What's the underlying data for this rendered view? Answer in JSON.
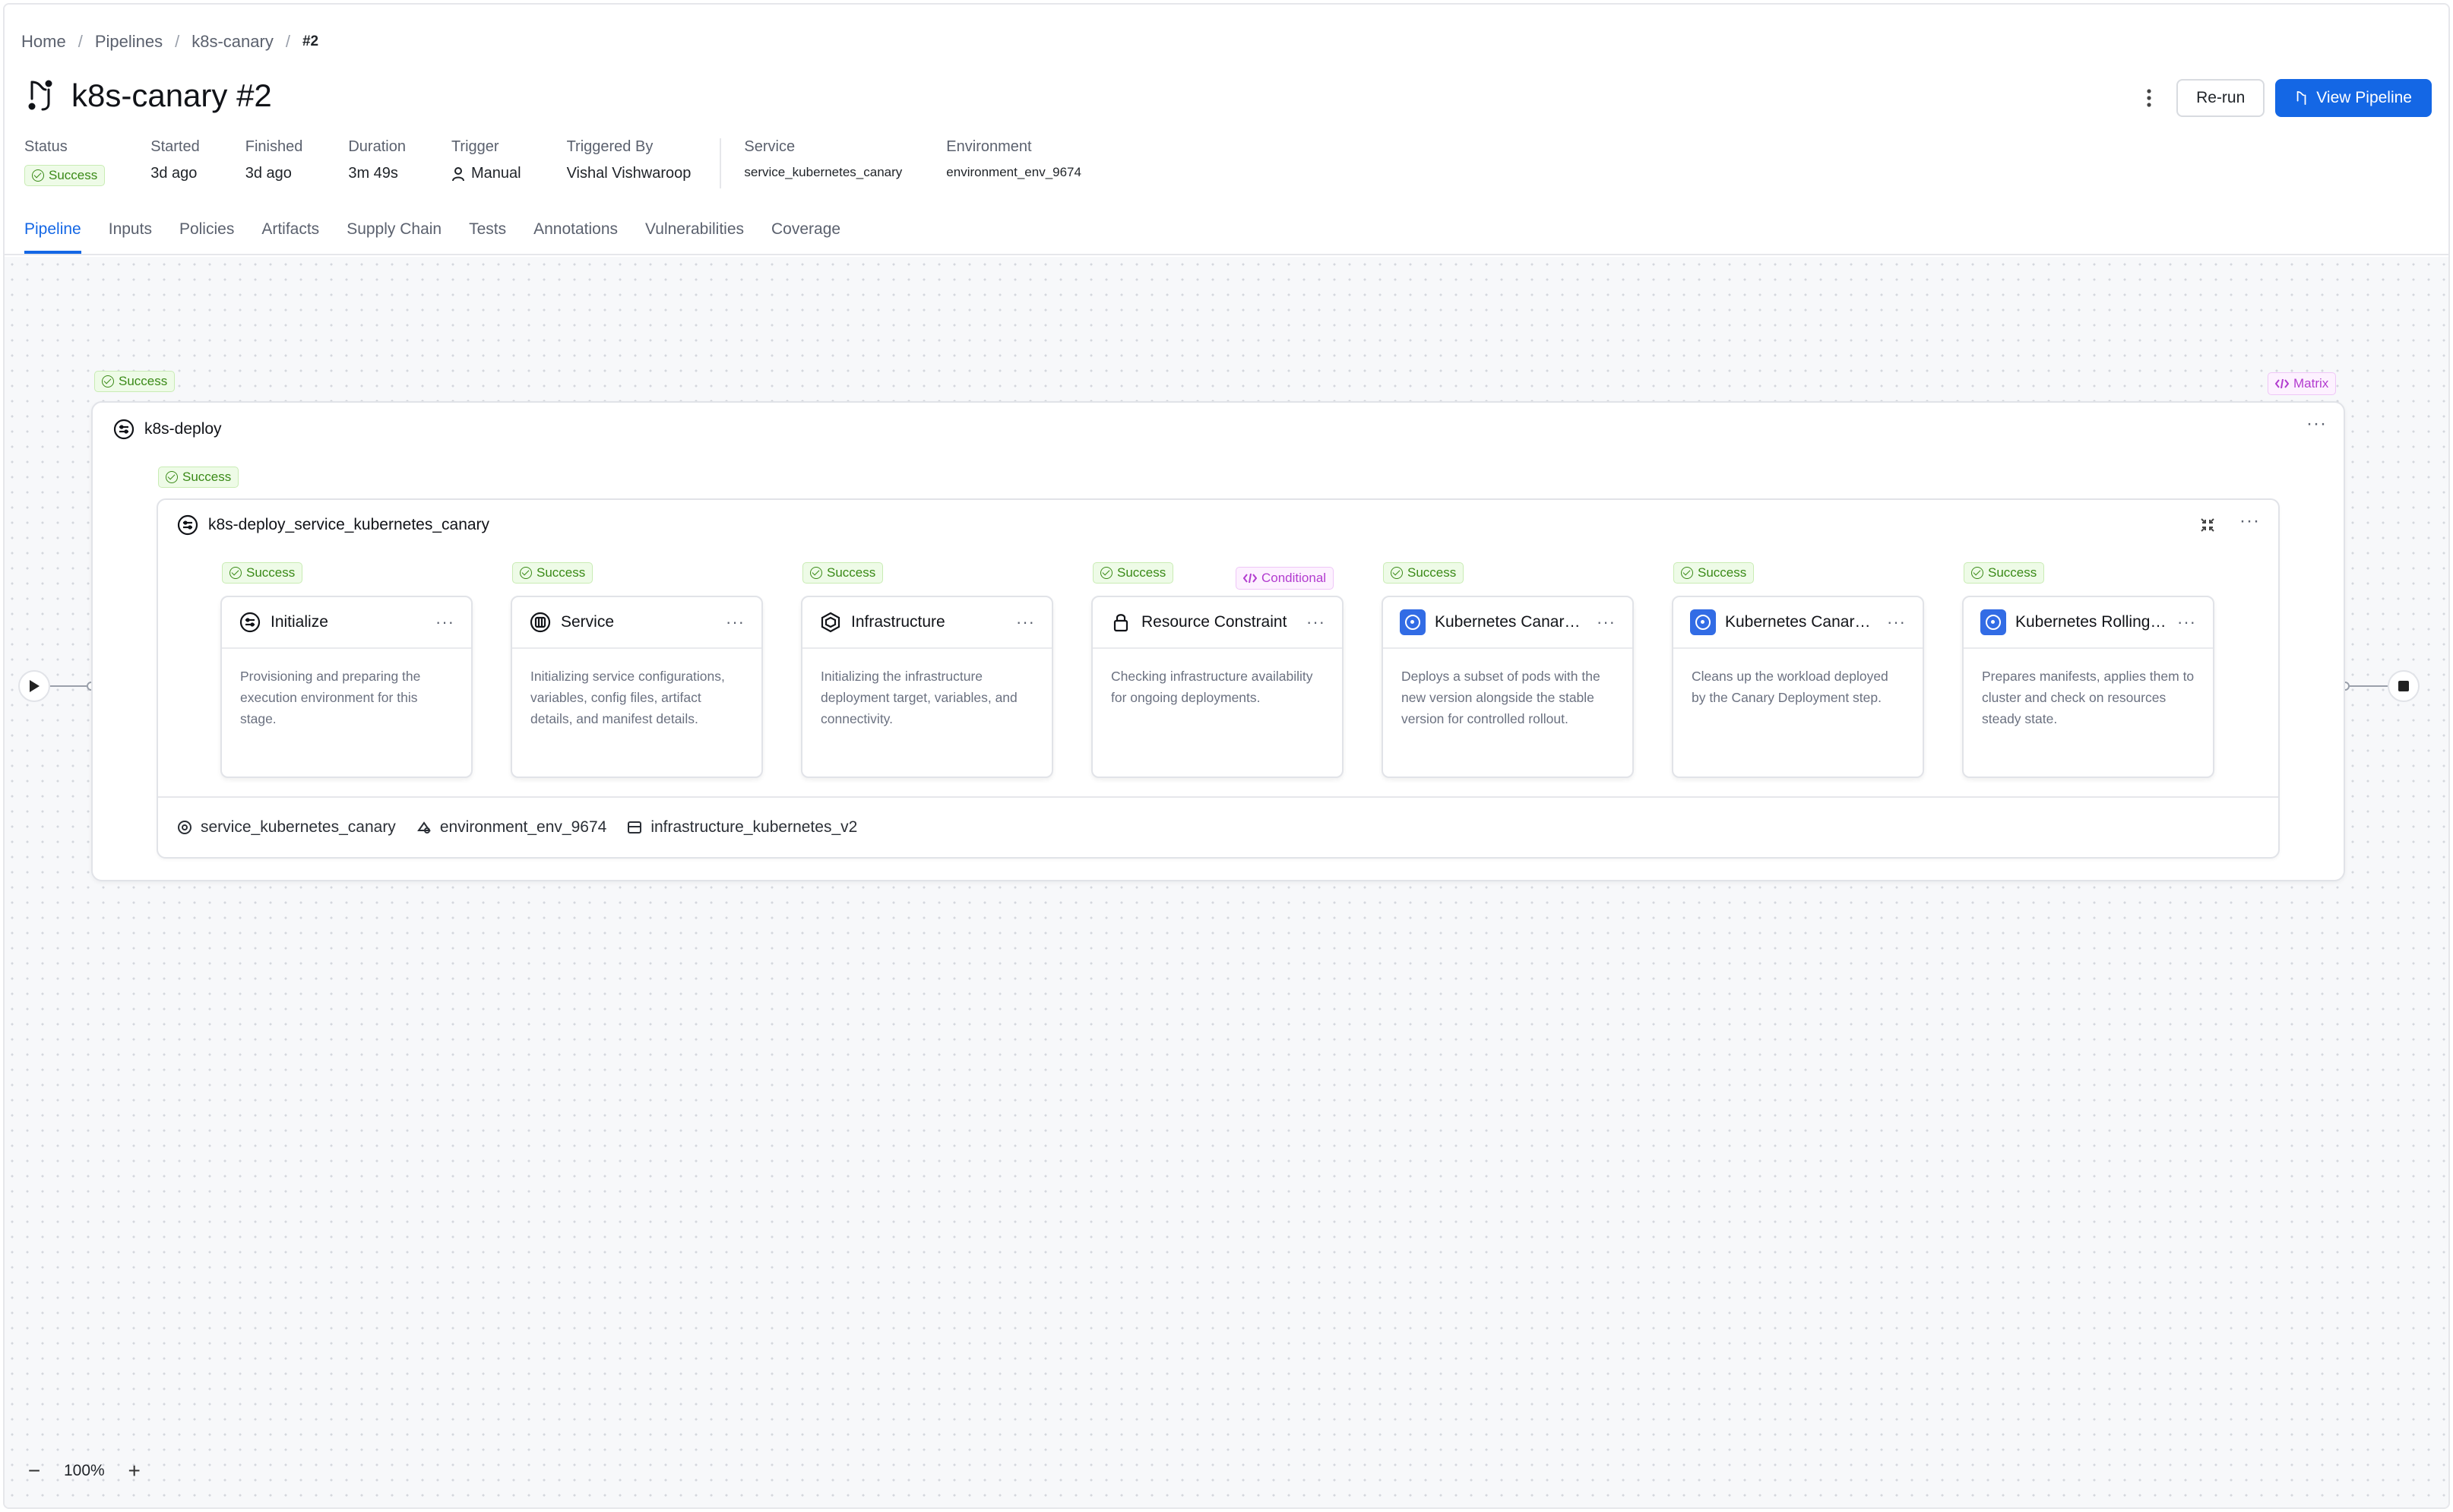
{
  "breadcrumb": {
    "home": "Home",
    "pipelines": "Pipelines",
    "pipeline": "k8s-canary",
    "run": "#2"
  },
  "title": "k8s-canary #2",
  "actions": {
    "rerun": "Re-run",
    "view_pipeline": "View Pipeline"
  },
  "meta": {
    "status_label": "Status",
    "status_value": "Success",
    "started_label": "Started",
    "started_value": "3d ago",
    "finished_label": "Finished",
    "finished_value": "3d ago",
    "duration_label": "Duration",
    "duration_value": "3m 49s",
    "trigger_label": "Trigger",
    "trigger_value": "Manual",
    "triggered_by_label": "Triggered By",
    "triggered_by_value": "Vishal Vishwaroop",
    "service_label": "Service",
    "service_value": "service_kubernetes_canary",
    "environment_label": "Environment",
    "environment_value": "environment_env_9674"
  },
  "tabs": [
    "Pipeline",
    "Inputs",
    "Policies",
    "Artifacts",
    "Supply Chain",
    "Tests",
    "Annotations",
    "Vulnerabilities",
    "Coverage"
  ],
  "active_tab": "Pipeline",
  "stage": {
    "status": "Success",
    "name": "k8s-deploy",
    "matrix_tag": "Matrix",
    "inner": {
      "status": "Success",
      "name": "k8s-deploy_service_kubernetes_canary",
      "footer": {
        "service": "service_kubernetes_canary",
        "environment": "environment_env_9674",
        "infrastructure": "infrastructure_kubernetes_v2"
      }
    }
  },
  "steps": [
    {
      "status": "Success",
      "name": "Initialize",
      "icon": "stage-icon",
      "desc": "Provisioning and preparing the execution environment for this stage."
    },
    {
      "status": "Success",
      "name": "Service",
      "icon": "service-icon",
      "desc": "Initializing service configurations, variables, config files, artifact details, and manifest details."
    },
    {
      "status": "Success",
      "name": "Infrastructure",
      "icon": "infrastructure-icon",
      "desc": "Initializing the infrastructure deployment target, variables, and connectivity."
    },
    {
      "status": "Success",
      "name": "Resource Constraint",
      "icon": "lock-icon",
      "desc": "Checking infrastructure availability for ongoing deployments.",
      "tag": "Conditional"
    },
    {
      "status": "Success",
      "name": "Kubernetes Canary Deployment",
      "icon": "kubernetes-icon",
      "desc": "Deploys a subset of pods with the new version alongside the stable version for controlled rollout."
    },
    {
      "status": "Success",
      "name": "Kubernetes Canary Delete",
      "icon": "kubernetes-icon",
      "desc": "Cleans up the workload deployed by the Canary Deployment step."
    },
    {
      "status": "Success",
      "name": "Kubernetes Rolling Deployment",
      "icon": "kubernetes-icon",
      "desc": "Prepares manifests, applies them to cluster and check on resources steady state."
    }
  ],
  "zoom": {
    "level": "100%"
  },
  "colors": {
    "primary": "#1467e5",
    "success": "#3a8a17",
    "conditional": "#b23bcf",
    "kubernetes": "#326ce5"
  }
}
